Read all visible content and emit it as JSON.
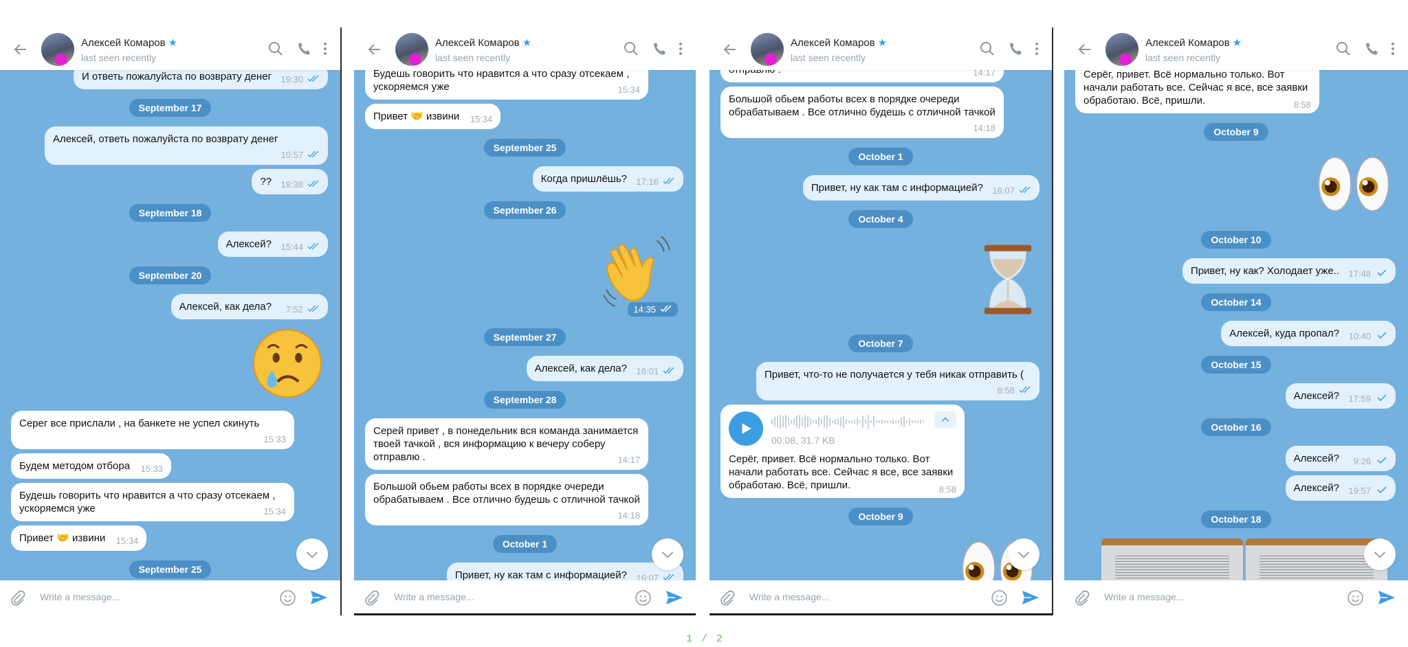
{
  "chat": {
    "header": {
      "name": "Алексей Комаров",
      "status": "last seen recently",
      "verified_icon": "star-icon"
    },
    "input_placeholder": "Write a message...",
    "colors": {
      "background": "#74b1df",
      "outgoing_bubble": "#e3f1fc",
      "incoming_bubble": "#ffffff",
      "date_pill": "#4c8fc5",
      "accent": "#3d9de3"
    }
  },
  "panels": [
    {
      "messages": [
        {
          "type": "out",
          "text": "И ответь пожалуйста по возврату денег",
          "time": "19:30",
          "status": "read"
        },
        {
          "type": "date",
          "text": "September 17"
        },
        {
          "type": "out",
          "text": "Алексей, ответь пожалуйста по возврату денег",
          "time": "10:57",
          "status": "read"
        },
        {
          "type": "out",
          "text": "??",
          "time": "19:38",
          "status": "read"
        },
        {
          "type": "date",
          "text": "September 18"
        },
        {
          "type": "out",
          "text": "Алексей?",
          "time": "15:44",
          "status": "read"
        },
        {
          "type": "date",
          "text": "September 20"
        },
        {
          "type": "out",
          "text": "Алексей, как дела?",
          "time": "7:52",
          "status": "read"
        },
        {
          "type": "sticker",
          "sticker": "crying-face"
        },
        {
          "type": "in",
          "text": "Серег все прислали , на банкете не успел скинуть",
          "time": "15:33"
        },
        {
          "type": "in",
          "text": "Будем методом отбора",
          "time": "15:33"
        },
        {
          "type": "in",
          "text": "Будешь говорить что нравится а что сразу отсекаем , ускоряемся уже",
          "time": "15:34"
        },
        {
          "type": "in",
          "text": "Привет 🤝 извини",
          "time": "15:34"
        },
        {
          "type": "date",
          "text": "September 25"
        }
      ]
    },
    {
      "messages": [
        {
          "type": "in",
          "text": "Будешь говорить что нравится а что сразу отсекаем , ускоряемся уже",
          "time": "15:34"
        },
        {
          "type": "in",
          "text": "Привет 🤝 извини",
          "time": "15:34"
        },
        {
          "type": "date",
          "text": "September 25"
        },
        {
          "type": "out",
          "text": "Когда пришлёшь?",
          "time": "17:16",
          "status": "read"
        },
        {
          "type": "date",
          "text": "September 26"
        },
        {
          "type": "sticker",
          "sticker": "waving-hand",
          "time": "14:35",
          "status": "read"
        },
        {
          "type": "date",
          "text": "September 27"
        },
        {
          "type": "out",
          "text": "Алексей, как дела?",
          "time": "16:01",
          "status": "read"
        },
        {
          "type": "date",
          "text": "September 28"
        },
        {
          "type": "in",
          "text": "Серей привет , в понедельник вся команда занимается твоей тачкой , вся информацию к вечеру соберу отправлю .",
          "time": "14:17"
        },
        {
          "type": "in",
          "text": "Большой обьем работы всех в порядке очереди обрабатываем . Все отлично будешь с отличной тачкой",
          "time": "14:18"
        },
        {
          "type": "date",
          "text": "October 1"
        },
        {
          "type": "out",
          "text": "Привет, ну как там с информацией?",
          "time": "16:07",
          "status": "read"
        }
      ]
    },
    {
      "messages": [
        {
          "type": "in",
          "text": "Серей привет , в понедельник вся команда занимается твоей тачкой , вся информацию к вечеру соберу отправлю .",
          "time": "14:17"
        },
        {
          "type": "in",
          "text": "Большой обьем работы всех в порядке очереди обрабатываем . Все отлично будешь с отличной тачкой",
          "time": "14:18"
        },
        {
          "type": "date",
          "text": "October 1"
        },
        {
          "type": "out",
          "text": "Привет, ну как там с информацией?",
          "time": "16:07",
          "status": "read"
        },
        {
          "type": "date",
          "text": "October 4"
        },
        {
          "type": "sticker",
          "sticker": "hourglass"
        },
        {
          "type": "date",
          "text": "October 7"
        },
        {
          "type": "out",
          "text": "Привет, что-то не получается у тебя никак отправить (",
          "time": "8:58",
          "status": "read"
        },
        {
          "type": "voice",
          "meta": "00:08, 31.7 KB",
          "text": "Серёг, привет. Всё нормально только. Вот начали работать все. Сейчас я все, все заявки обработаю. Всё, пришли.",
          "time": "8:58"
        },
        {
          "type": "date",
          "text": "October 9"
        },
        {
          "type": "sticker",
          "sticker": "eyes"
        }
      ]
    },
    {
      "messages": [
        {
          "type": "voice",
          "meta": "00:08, 31.7 KB",
          "text": "Серёг, привет. Всё нормально только. Вот начали работать все. Сейчас я все, все заявки обработаю. Всё, пришли.",
          "time": "8:58"
        },
        {
          "type": "date",
          "text": "October 9"
        },
        {
          "type": "sticker",
          "sticker": "eyes"
        },
        {
          "type": "date",
          "text": "October 10"
        },
        {
          "type": "out",
          "text": "Привет, ну как? Холодает уже..",
          "time": "17:48",
          "status": "sent"
        },
        {
          "type": "date",
          "text": "October 14"
        },
        {
          "type": "out",
          "text": "Алексей, куда пропал?",
          "time": "10:40",
          "status": "sent"
        },
        {
          "type": "date",
          "text": "October 15"
        },
        {
          "type": "out",
          "text": "Алексей?",
          "time": "17:59",
          "status": "sent"
        },
        {
          "type": "date",
          "text": "October 16"
        },
        {
          "type": "out",
          "text": "Алексей?",
          "time": "9:26",
          "status": "sent"
        },
        {
          "type": "out",
          "text": "Алексей?",
          "time": "19:57",
          "status": "sent"
        },
        {
          "type": "date",
          "text": "October 18"
        },
        {
          "type": "photos",
          "count": 2
        }
      ]
    }
  ],
  "pager": "1 / 2"
}
